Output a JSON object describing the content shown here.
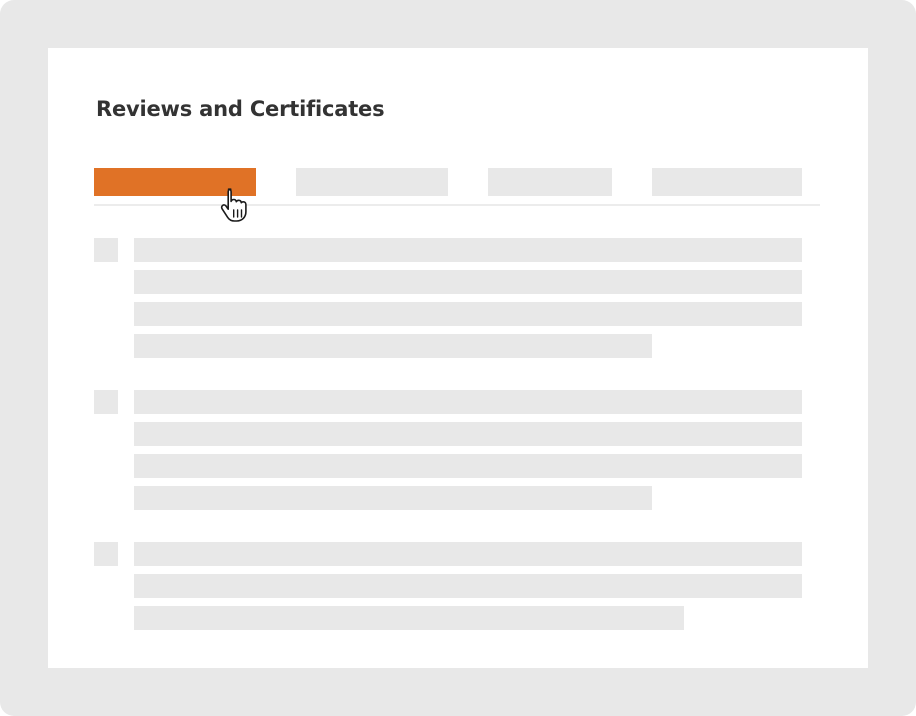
{
  "header": {
    "title": "Reviews and Certificates"
  },
  "tabs": {
    "active_index": 0,
    "count": 4
  },
  "colors": {
    "accent": "#e07226",
    "placeholder": "#e8e8e8",
    "frame": "#e8e8e8",
    "panel": "#ffffff",
    "title": "#333333"
  },
  "icons": {
    "cursor": "hand-pointer-icon"
  }
}
